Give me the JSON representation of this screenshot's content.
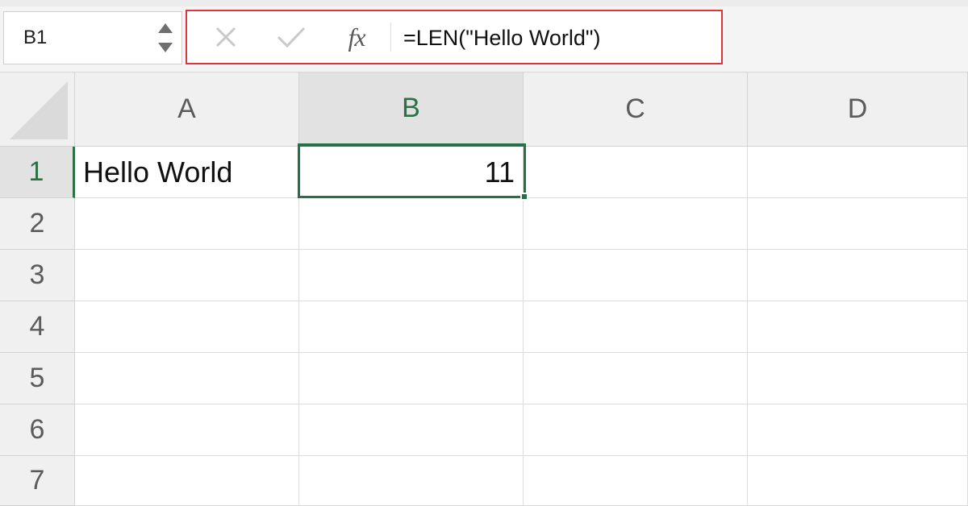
{
  "name_box": {
    "value": "B1"
  },
  "formula_bar": {
    "fx_label": "fx",
    "formula": "=LEN(\"Hello World\")"
  },
  "columns": [
    "A",
    "B",
    "C",
    "D"
  ],
  "rows": [
    "1",
    "2",
    "3",
    "4",
    "5",
    "6",
    "7"
  ],
  "cells": {
    "A1": "Hello World",
    "B1": "11"
  },
  "selection": {
    "cell": "B1",
    "column": "B",
    "row": "1"
  },
  "colors": {
    "selection": "#217346",
    "formula_highlight": "#d9363e",
    "header_bg": "#f0f0f0"
  },
  "icons": {
    "cancel": "close-icon",
    "enter": "check-icon",
    "function": "fx-icon",
    "spinner": "spinner-arrows-icon"
  }
}
